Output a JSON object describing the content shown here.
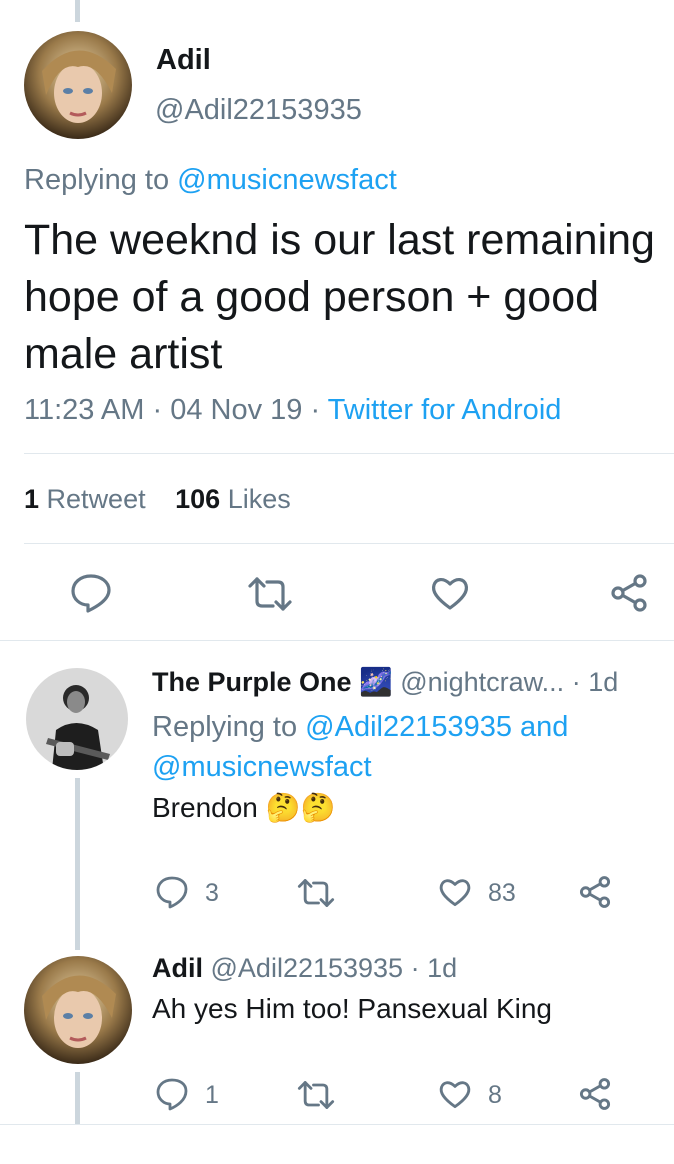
{
  "main_tweet": {
    "name": "Adil",
    "handle": "@Adil22153935",
    "replying_prefix": "Replying to",
    "replying_to": "@musicnewsfact",
    "text_line1": "The weeknd is our last remaining",
    "text_line2": "hope of a good person + good",
    "text_line3": "male artist",
    "time": "11:23 AM",
    "sep1": "·",
    "date": "04 Nov 19",
    "sep2": "·",
    "source": "Twitter for Android",
    "retweet_count": "1",
    "retweet_label": "Retweet",
    "like_count": "106",
    "like_label": "Likes"
  },
  "reply1": {
    "name": "The Purple One",
    "flag_emoji": "🌌",
    "handle": "@nightcraw...",
    "age": "· 1d",
    "replying_prefix": "Replying to",
    "replying_user1": "@Adil22153935",
    "replying_and": "and",
    "replying_user2": "@musicnewsfact",
    "text": "Brendon",
    "emoji": "🤔🤔",
    "reply_count": "3",
    "like_count": "83"
  },
  "reply2": {
    "name": "Adil",
    "handle": "@Adil22153935",
    "age": "· 1d",
    "text": "Ah yes Him too! Pansexual King",
    "reply_count": "1",
    "like_count": "8"
  },
  "icons": {
    "reply": "reply-bubble-icon",
    "retweet": "retweet-icon",
    "like": "heart-icon",
    "share": "share-icon"
  },
  "colors": {
    "link": "#1da1f2",
    "muted": "#657786",
    "divider": "#e1e8ed",
    "thread_line": "#ccd6dd"
  }
}
